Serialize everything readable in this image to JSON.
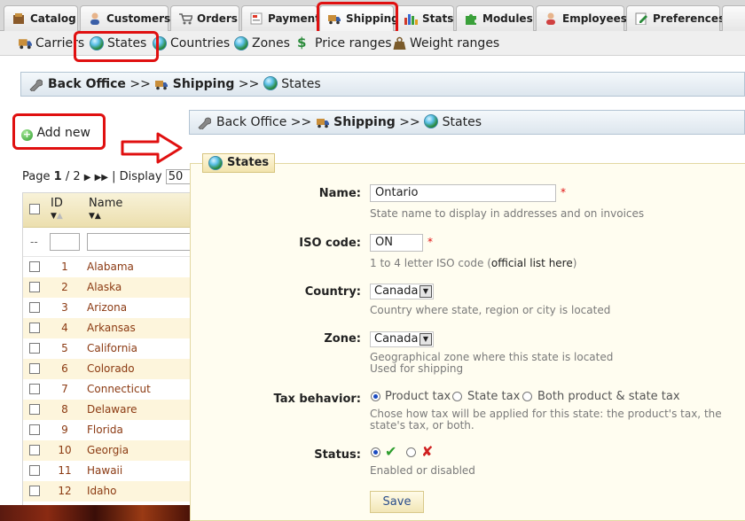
{
  "tabs": [
    {
      "label": "Catalog",
      "icon": "catalog-icon"
    },
    {
      "label": "Customers",
      "icon": "customers-icon"
    },
    {
      "label": "Orders",
      "icon": "cart-icon"
    },
    {
      "label": "Payment",
      "icon": "payment-icon"
    },
    {
      "label": "Shipping",
      "icon": "truck-icon",
      "active": true
    },
    {
      "label": "Stats",
      "icon": "stats-icon"
    },
    {
      "label": "Modules",
      "icon": "puzzle-icon"
    },
    {
      "label": "Employees",
      "icon": "employee-icon"
    },
    {
      "label": "Preferences",
      "icon": "preferences-icon"
    }
  ],
  "submenu": [
    {
      "label": "Carriers",
      "icon": "truck-icon"
    },
    {
      "label": "States",
      "icon": "globe-icon"
    },
    {
      "label": "Countries",
      "icon": "globe-icon"
    },
    {
      "label": "Zones",
      "icon": "globe-icon"
    },
    {
      "label": "Price ranges",
      "icon": "dollar-icon"
    },
    {
      "label": "Weight ranges",
      "icon": "weight-icon"
    }
  ],
  "breadcrumb": {
    "home": "Back Office",
    "sep": ">>",
    "section": "Shipping",
    "page": "States"
  },
  "add_new": "Add new",
  "pagination": {
    "prefix": "Page",
    "current": "1",
    "of": "/ 2",
    "display": "| Display",
    "per_page": "50"
  },
  "list": {
    "col_id": "ID",
    "col_name": "Name",
    "filter_dash": "--",
    "rows": [
      {
        "id": "1",
        "name": "Alabama"
      },
      {
        "id": "2",
        "name": "Alaska"
      },
      {
        "id": "3",
        "name": "Arizona"
      },
      {
        "id": "4",
        "name": "Arkansas"
      },
      {
        "id": "5",
        "name": "California"
      },
      {
        "id": "6",
        "name": "Colorado"
      },
      {
        "id": "7",
        "name": "Connecticut"
      },
      {
        "id": "8",
        "name": "Delaware"
      },
      {
        "id": "9",
        "name": "Florida"
      },
      {
        "id": "10",
        "name": "Georgia"
      },
      {
        "id": "11",
        "name": "Hawaii"
      },
      {
        "id": "12",
        "name": "Idaho"
      }
    ]
  },
  "form": {
    "legend": "States",
    "name_label": "Name:",
    "name_value": "Ontario",
    "name_hint": "State name to display in addresses and on invoices",
    "required_mark": "*",
    "iso_label": "ISO code:",
    "iso_value": "ON",
    "iso_hint_pre": "1 to 4 letter ISO code (",
    "iso_hint_link": "official list here",
    "iso_hint_post": ")",
    "country_label": "Country:",
    "country_value": "Canada",
    "country_hint": "Country where state, region or city is located",
    "zone_label": "Zone:",
    "zone_value": "Canada",
    "zone_hint_1": "Geographical zone where this state is located",
    "zone_hint_2": "Used for shipping",
    "tax_label": "Tax behavior:",
    "tax_options": [
      "Product tax",
      "State tax",
      "Both product & state tax"
    ],
    "tax_hint_1": "Chose how tax will be applied for this state: the product's tax, the",
    "tax_hint_2": "state's tax, or both.",
    "status_label": "Status:",
    "status_hint": "Enabled or disabled",
    "save": "Save"
  },
  "colors": {
    "highlight": "#e01010",
    "link": "#8b3a12",
    "enabled": "#2e9e2e",
    "disabled": "#d02020"
  }
}
